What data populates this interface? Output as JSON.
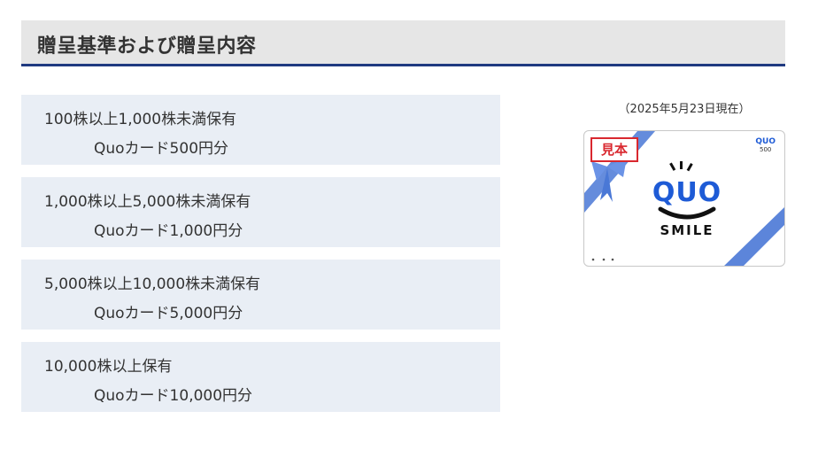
{
  "section": {
    "title": "贈呈基準および贈呈内容"
  },
  "tiers": [
    {
      "condition": "100株以上1,000株未満保有",
      "reward": "Quoカード500円分"
    },
    {
      "condition": "1,000株以上5,000株未満保有",
      "reward": "Quoカード1,000円分"
    },
    {
      "condition": "5,000株以上10,000株未満保有",
      "reward": "Quoカード5,000円分"
    },
    {
      "condition": "10,000株以上保有",
      "reward": "Quoカード10,000円分"
    }
  ],
  "card_image": {
    "date_note": "（2025年5月23日現在）",
    "sample_label": "見本",
    "brand": "QUO",
    "brand_sub": "SMILE",
    "corner_brand": "QUO",
    "corner_value": "500"
  },
  "colors": {
    "header_bg": "#e6e6e6",
    "header_rule": "#1f3a80",
    "tier_bg": "#e9eef5",
    "brand_blue": "#1e5bd6",
    "ribbon_blue": "#4a78d6",
    "stamp_red": "#d9282f"
  }
}
